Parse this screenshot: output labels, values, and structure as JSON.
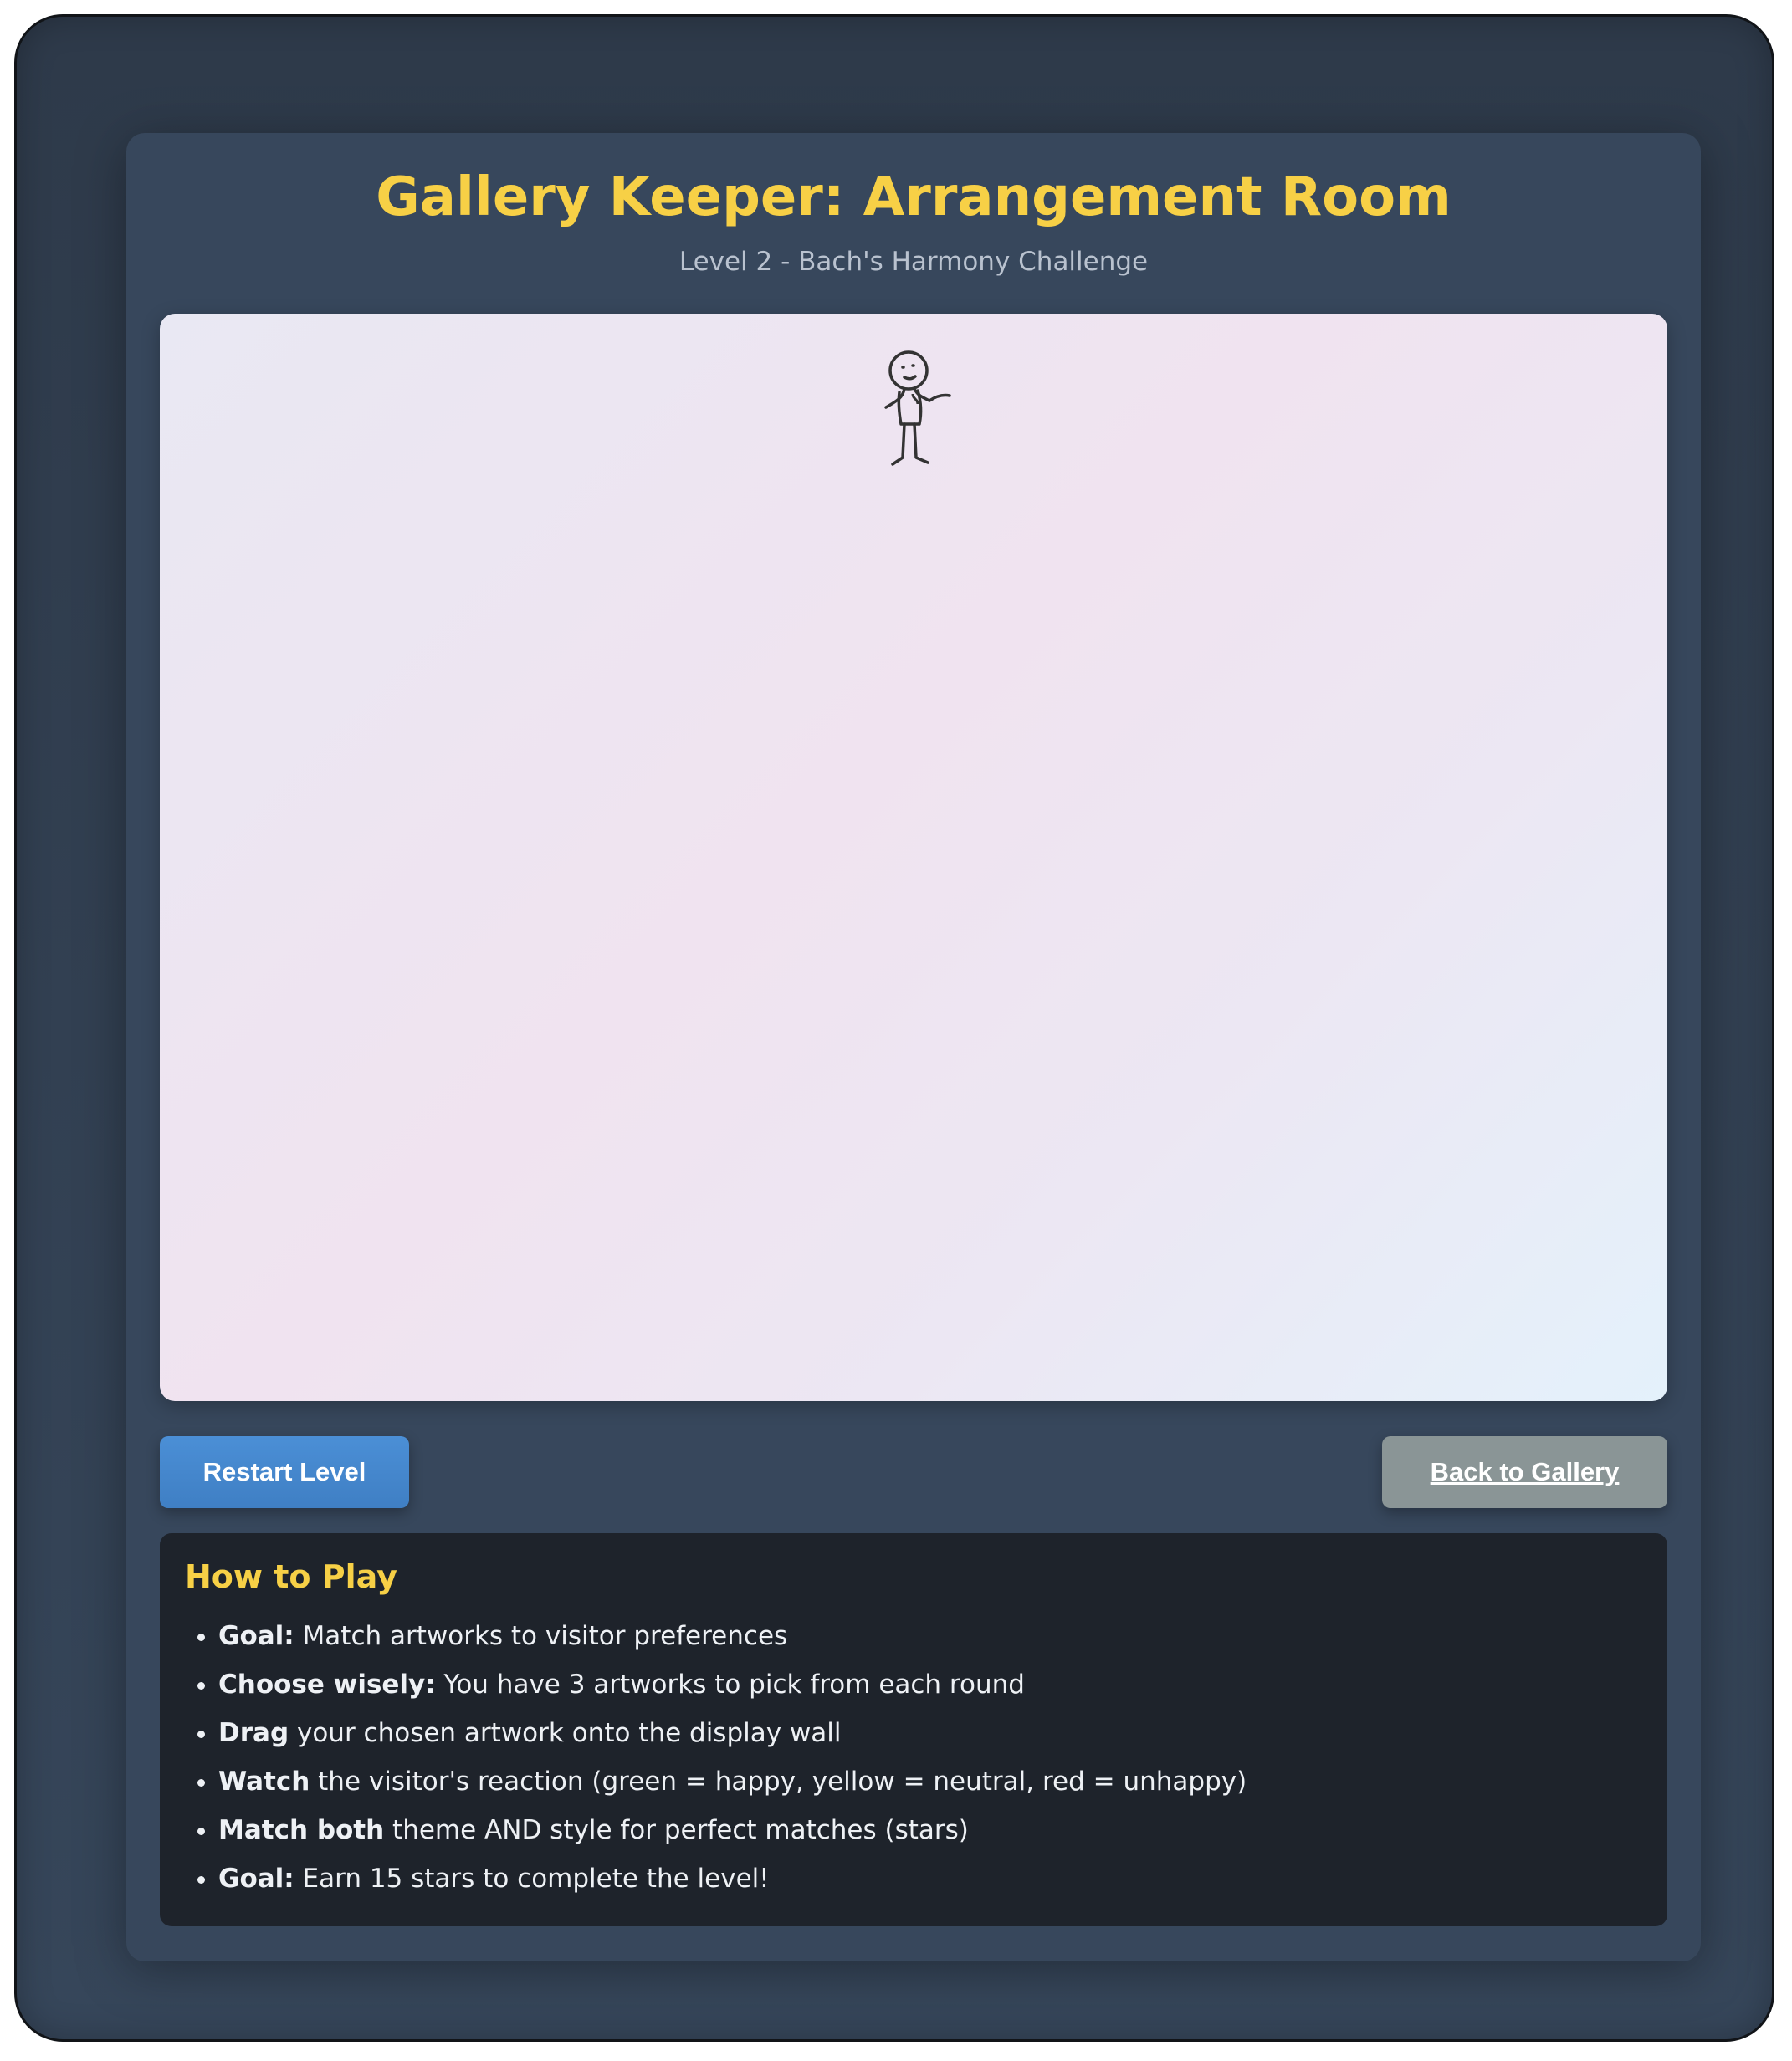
{
  "header": {
    "title": "Gallery Keeper: Arrangement Room",
    "subtitle": "Level 2 - Bach's Harmony Challenge"
  },
  "stage": {
    "visitor_icon": "stick-figure-visitor-icon"
  },
  "controls": {
    "restart_label": "Restart Level",
    "back_label": "Back to Gallery"
  },
  "howto": {
    "title": "How to Play",
    "items": [
      {
        "bold": "Goal:",
        "text": " Match artworks to visitor preferences"
      },
      {
        "bold": "Choose wisely:",
        "text": " You have 3 artworks to pick from each round"
      },
      {
        "bold": "Drag",
        "text": " your chosen artwork onto the display wall"
      },
      {
        "bold": "Watch",
        "text": " the visitor's reaction (green = happy, yellow = neutral, red = unhappy)"
      },
      {
        "bold": "Match both",
        "text": " theme AND style for perfect matches (stars)"
      },
      {
        "bold": "Goal:",
        "text": " Earn 15 stars to complete the level!"
      }
    ]
  },
  "colors": {
    "accent_title": "#f7d046",
    "restart_button": "#4b8fd6",
    "back_button": "#8a9596",
    "panel": "#37475c",
    "howto_bg": "#1e232b"
  }
}
